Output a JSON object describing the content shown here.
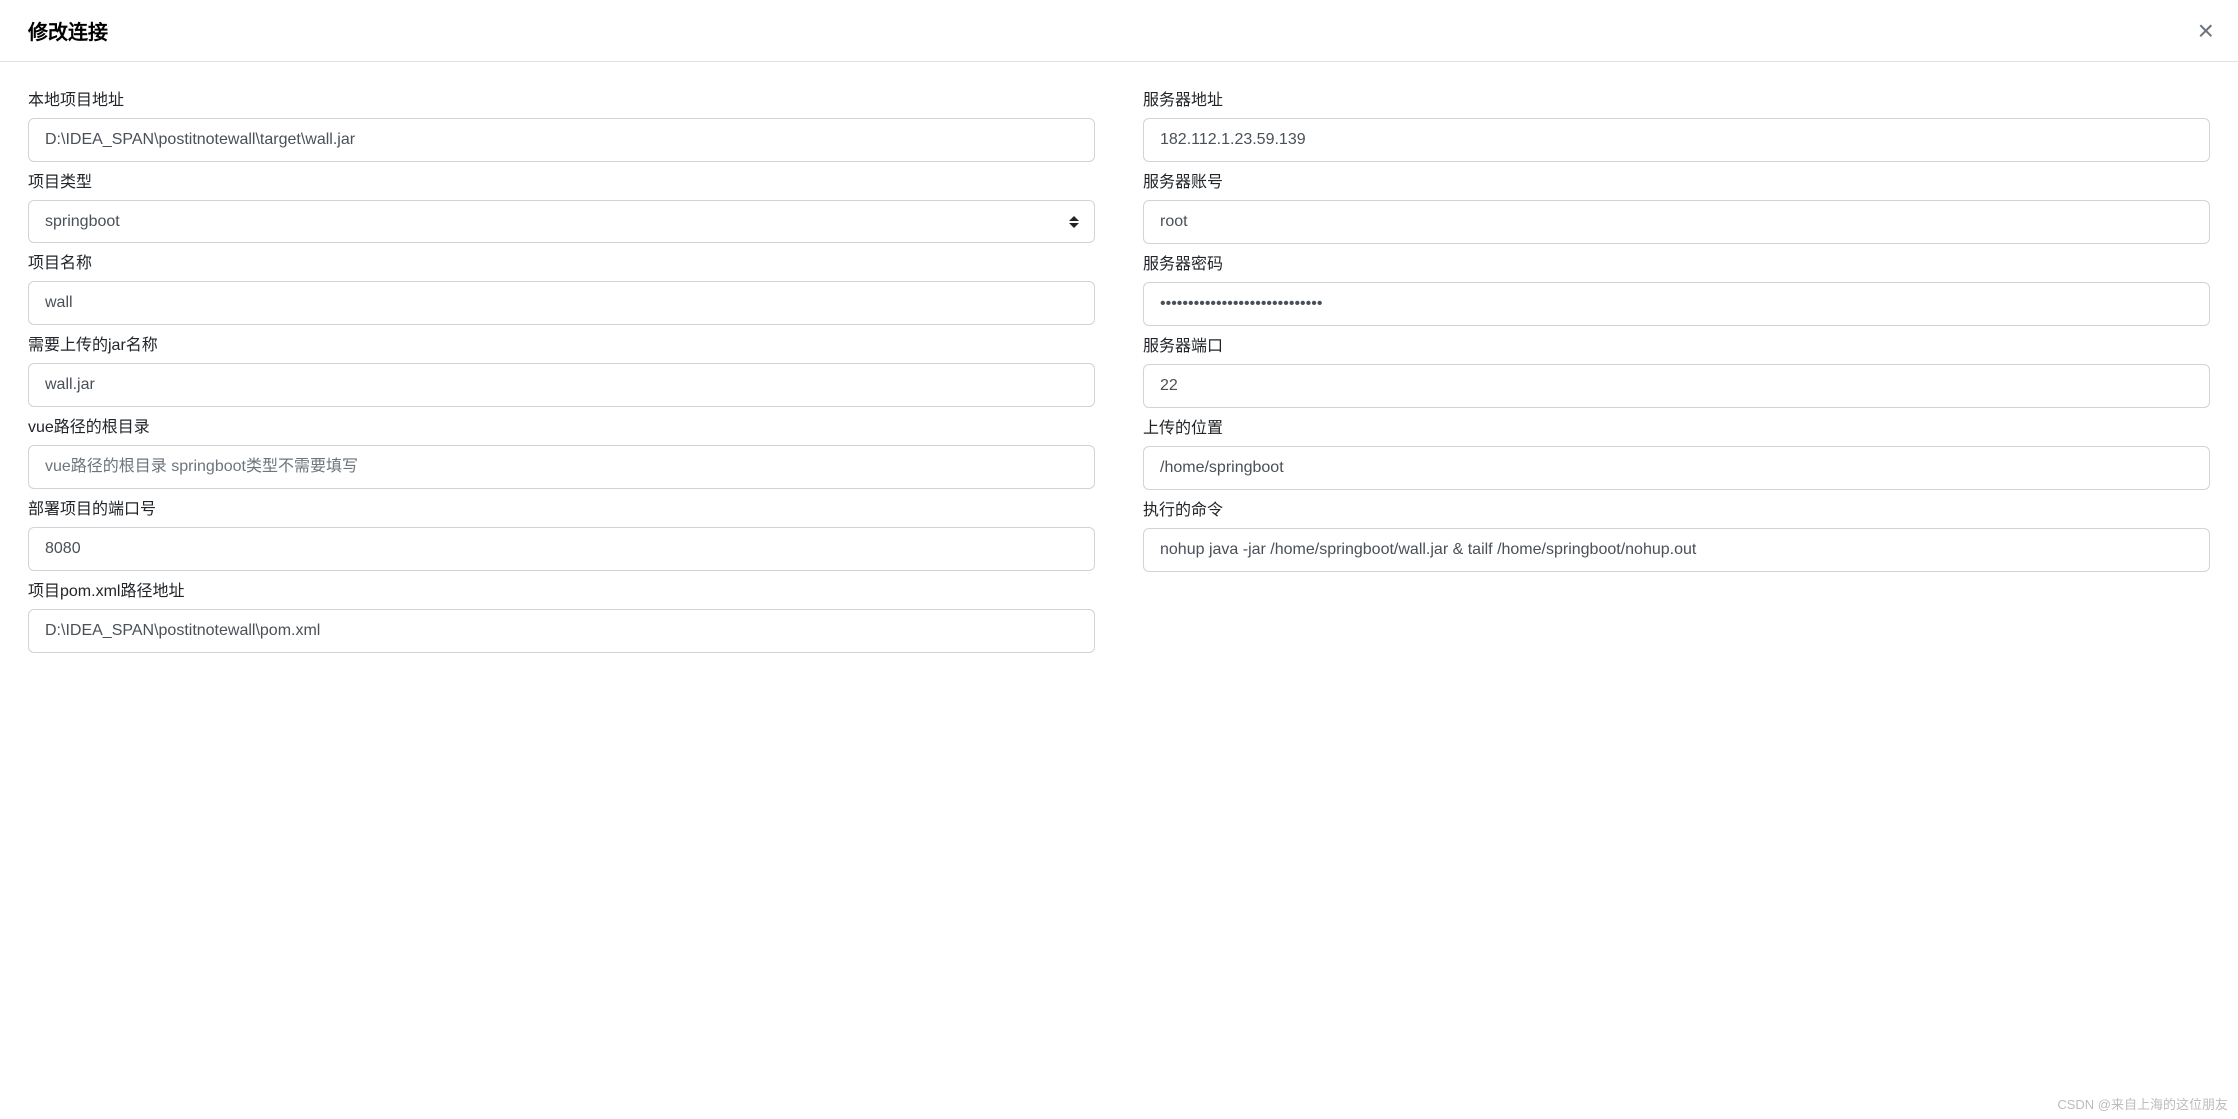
{
  "modal": {
    "title": "修改连接"
  },
  "left": {
    "local_path": {
      "label": "本地项目地址",
      "value": "D:\\IDEA_SPAN\\postitnotewall\\target\\wall.jar"
    },
    "project_type": {
      "label": "项目类型",
      "value": "springboot"
    },
    "project_name": {
      "label": "项目名称",
      "value": "wall"
    },
    "jar_name": {
      "label": "需要上传的jar名称",
      "value": "wall.jar"
    },
    "vue_root": {
      "label": "vue路径的根目录",
      "value": "",
      "placeholder": "vue路径的根目录 springboot类型不需要填写"
    },
    "deploy_port": {
      "label": "部署项目的端口号",
      "value": "8080"
    },
    "pom_path": {
      "label": "项目pom.xml路径地址",
      "value": "D:\\IDEA_SPAN\\postitnotewall\\pom.xml"
    }
  },
  "right": {
    "server_addr": {
      "label": "服务器地址",
      "value": "182.112.1.23.59.139"
    },
    "server_user": {
      "label": "服务器账号",
      "value": "root"
    },
    "server_password": {
      "label": "服务器密码",
      "value": "•••••••••••••••••••••••••••••"
    },
    "server_port": {
      "label": "服务器端口",
      "value": "22"
    },
    "upload_path": {
      "label": "上传的位置",
      "value": "/home/springboot"
    },
    "exec_cmd": {
      "label": "执行的命令",
      "value": "nohup java -jar /home/springboot/wall.jar & tailf /home/springboot/nohup.out"
    }
  },
  "watermark": "CSDN @来自上海的这位朋友"
}
